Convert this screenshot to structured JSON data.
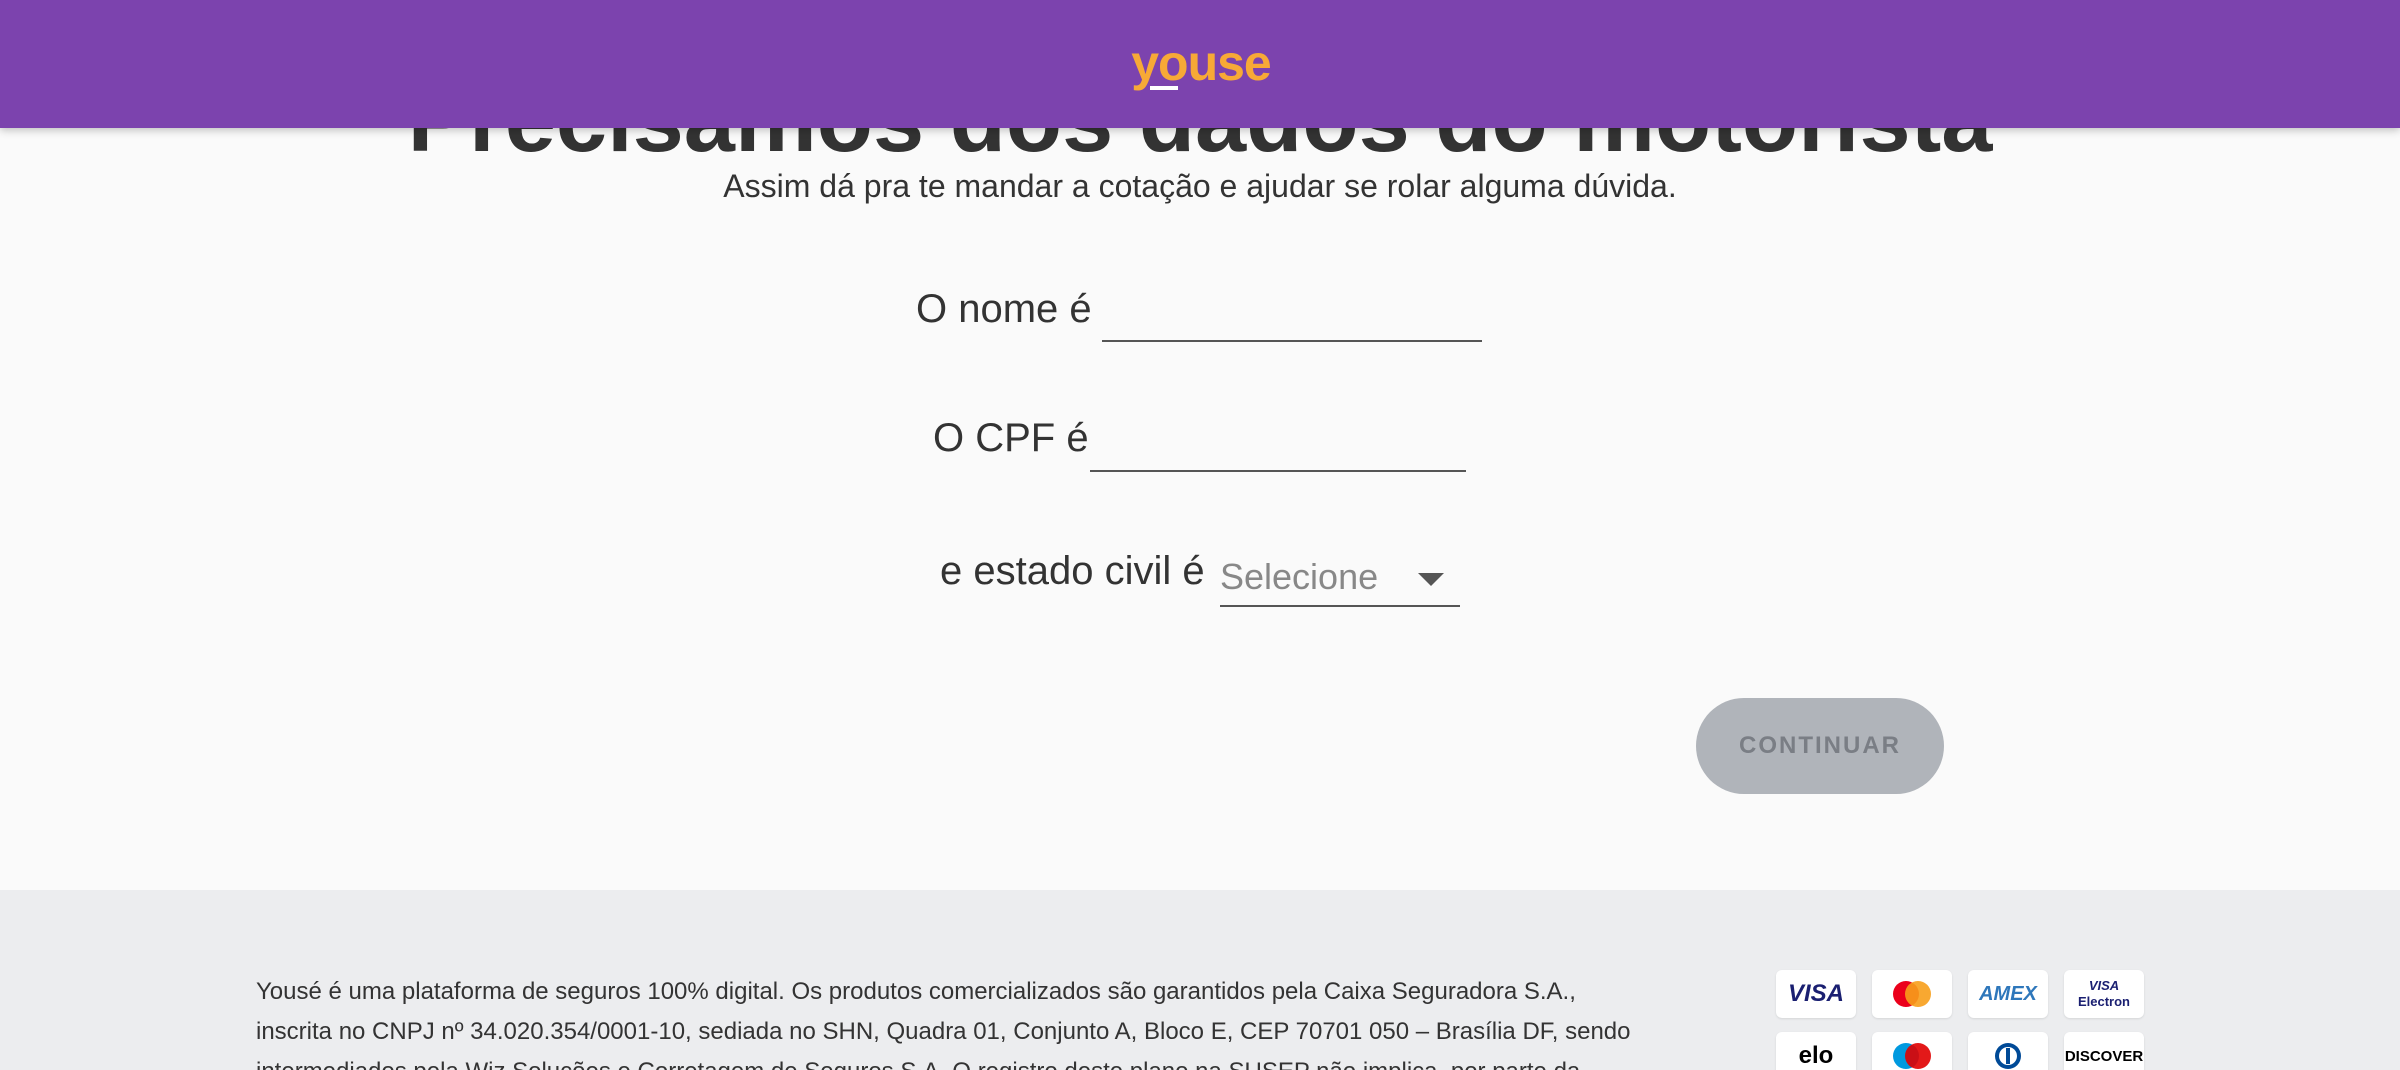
{
  "header": {
    "logo_text": "youse"
  },
  "main": {
    "title": "Precisamos dos dados do motorista",
    "subtitle": "Assim dá pra te mandar a cotação e ajudar se rolar alguma dúvida."
  },
  "form": {
    "name_label": "O nome é",
    "name_value": "",
    "cpf_label": "O CPF é",
    "cpf_value": "",
    "civil_status_label": "e estado civil é",
    "civil_status_value": "Selecione"
  },
  "actions": {
    "continue_label": "CONTINUAR"
  },
  "footer": {
    "legal_text": "Yousé é uma plataforma de seguros 100% digital. Os produtos comercializados são garantidos pela Caixa Seguradora S.A., inscrita no CNPJ nº 34.020.354/0001-10, sediada no SHN, Quadra 01, Conjunto A, Bloco E, CEP 70701 050 – Brasília DF, sendo intermediados pela Wiz Soluções e Corretagem de Seguros S.A. O registro deste plano na SUSEP não implica, por parte da",
    "cards": [
      {
        "name": "VISA",
        "icon": "visa-icon"
      },
      {
        "name": "Mastercard",
        "icon": "mastercard-icon"
      },
      {
        "name": "AMEX",
        "icon": "amex-icon"
      },
      {
        "name": "VISA Electron",
        "icon": "visa-electron-icon"
      },
      {
        "name": "elo",
        "icon": "elo-icon"
      },
      {
        "name": "Maestro",
        "icon": "maestro-icon"
      },
      {
        "name": "Diners",
        "icon": "diners-icon"
      },
      {
        "name": "DISCOVER",
        "icon": "discover-icon"
      }
    ]
  },
  "colors": {
    "header": "#7c43ae",
    "logo": "#f7a936",
    "button_disabled": "#b0b4ba",
    "footer_bg": "#ecedef"
  }
}
